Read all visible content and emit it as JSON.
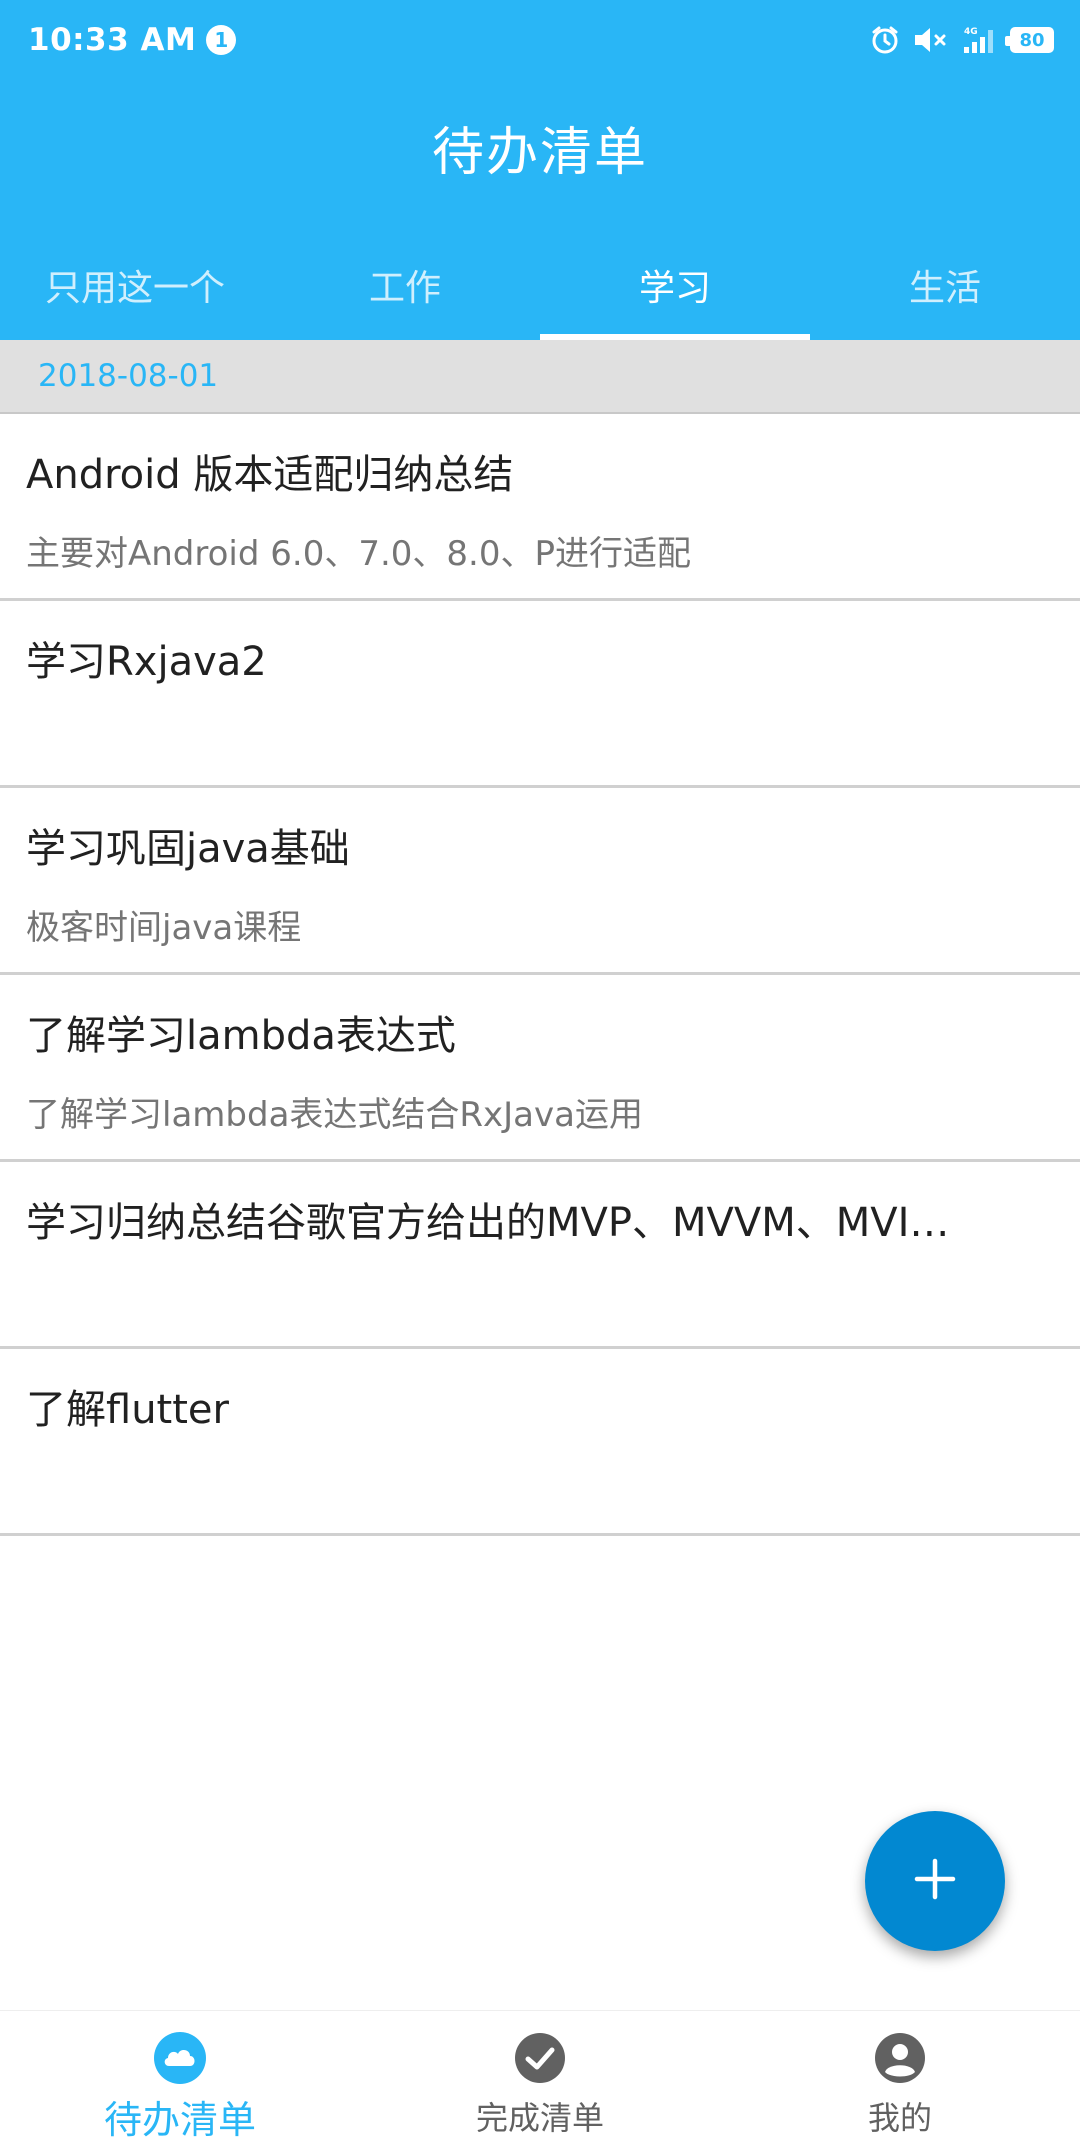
{
  "status_bar": {
    "time": "10:33 AM",
    "notification_count": "1",
    "network": "4G",
    "battery": "80",
    "icons": [
      "alarm-icon",
      "mute-icon",
      "signal-icon",
      "battery-icon"
    ]
  },
  "app_bar": {
    "title": "待办清单"
  },
  "tabs": [
    {
      "label": "只用这一个",
      "active": false
    },
    {
      "label": "工作",
      "active": false
    },
    {
      "label": "学习",
      "active": true
    },
    {
      "label": "生活",
      "active": false
    }
  ],
  "section": {
    "date": "2018-08-01"
  },
  "todos": [
    {
      "title": "Android 版本适配归纳总结",
      "description": "主要对Android 6.0、7.0、8.0、P进行适配"
    },
    {
      "title": "学习Rxjava2",
      "description": ""
    },
    {
      "title": "学习巩固java基础",
      "description": "极客时间java课程"
    },
    {
      "title": "了解学习lambda表达式",
      "description": "了解学习lambda表达式结合RxJava运用"
    },
    {
      "title": "学习归纳总结谷歌官方给出的MVP、MVVM、MVI…",
      "description": ""
    },
    {
      "title": "了解flutter",
      "description": ""
    }
  ],
  "fab": {
    "icon": "plus-icon"
  },
  "bottom_nav": [
    {
      "label": "待办清单",
      "icon": "cloud-icon",
      "active": true
    },
    {
      "label": "完成清单",
      "icon": "check-circle-icon",
      "active": false
    },
    {
      "label": "我的",
      "icon": "account-circle-icon",
      "active": false
    }
  ],
  "colors": {
    "primary": "#29b6f6",
    "fab": "#0288d1",
    "header_bg": "#e0e0e0",
    "title_text": "#212121",
    "desc_text": "#757575"
  }
}
